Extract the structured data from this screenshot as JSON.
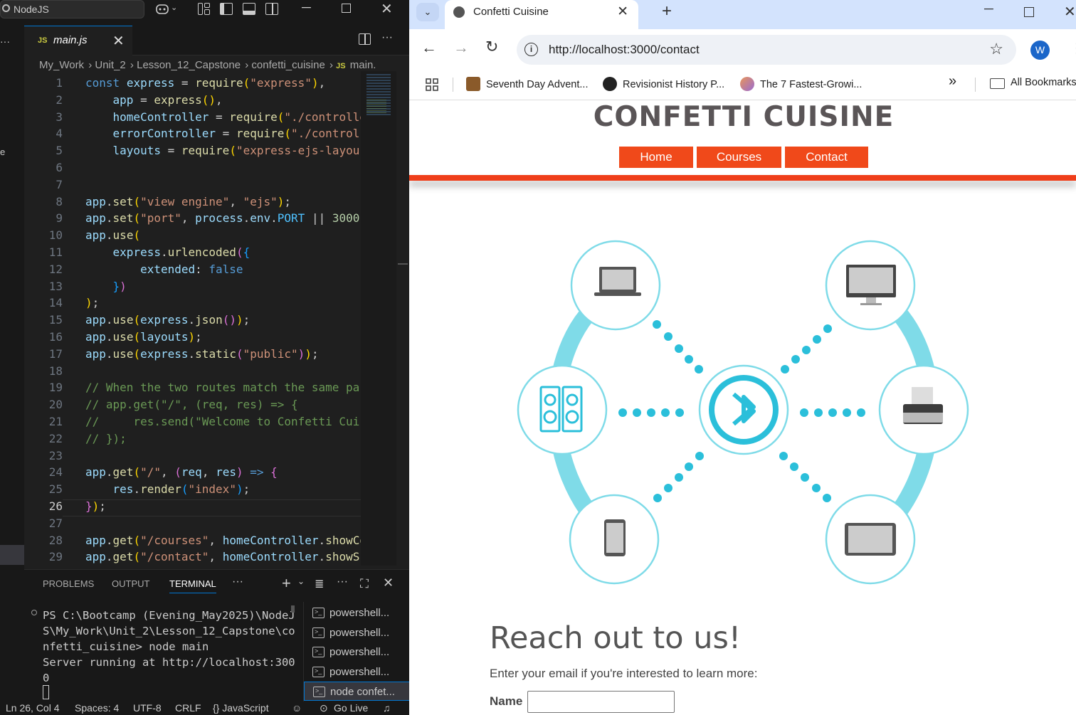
{
  "vscode": {
    "search_label": "NodeJS",
    "tab": {
      "badge": "JS",
      "name": "main.js",
      "close": "✕"
    },
    "breadcrumb": [
      "My_Work",
      "Unit_2",
      "Lesson_12_Capstone",
      "confetti_cuisine",
      "JS",
      "main."
    ],
    "panel_tabs": [
      "PROBLEMS",
      "OUTPUT",
      "TERMINAL",
      "···"
    ],
    "terminal_output": "PS C:\\Bootcamp (Evening_May2025)\\NodeJ\nS\\My_Work\\Unit_2\\Lesson_12_Capstone\\co\nnfetti_cuisine> node main\nServer running at http://localhost:300\n0",
    "terminals": [
      "powershell...",
      "powershell...",
      "powershell...",
      "powershell...",
      "node  confet..."
    ],
    "status": {
      "position": "Ln 26, Col 4",
      "spaces": "Spaces: 4",
      "encoding": "UTF-8",
      "eol": "CRLF",
      "language": "{} JavaScript",
      "golive": "Go Live"
    }
  },
  "browser": {
    "tab_title": "Confetti Cuisine",
    "url": "http://localhost:3000/contact",
    "profile_initial": "W",
    "bookmarks": [
      "Seventh Day Advent...",
      "Revisionist History P...",
      "The 7 Fastest-Growi...",
      "All Bookmarks"
    ],
    "bookmark_overflow": "»"
  },
  "site": {
    "title": "CONFETTI CUISINE",
    "nav": [
      "Home",
      "Courses",
      "Contact"
    ],
    "heading": "Reach out to us!",
    "subtext": "Enter your email if you're interested to learn more:",
    "name_label": "Name",
    "name_value": ""
  },
  "colors": {
    "accent": "#f0491a",
    "bar": "#ef3e1a",
    "bluetooth": "#2bbfda"
  },
  "icons": {
    "graphic_devices": [
      "laptop-icon",
      "desktop-monitor-icon",
      "speaker-icon",
      "bluetooth-icon",
      "printer-icon",
      "smartphone-icon",
      "tablet-icon"
    ]
  }
}
